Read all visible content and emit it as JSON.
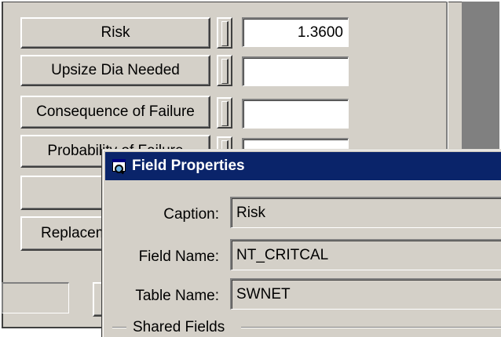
{
  "form": {
    "rows": [
      {
        "button": "Risk",
        "value": "1.3600"
      },
      {
        "button": "Upsize Dia Needed",
        "value": ""
      },
      {
        "button": "Consequence of Failure",
        "value": ""
      },
      {
        "button": "Probability of Failure",
        "value": ""
      },
      {
        "button": "",
        "value": ""
      },
      {
        "button": "Replacement",
        "value": ""
      }
    ]
  },
  "dialog": {
    "title": "Field Properties",
    "icon": "field-properties-icon",
    "fields": [
      {
        "label": "Caption:",
        "value": "Risk"
      },
      {
        "label": "Field Name:",
        "value": "NT_CRITCAL"
      },
      {
        "label": "Table Name:",
        "value": "SWNET"
      }
    ],
    "group_label": "Shared Fields"
  }
}
